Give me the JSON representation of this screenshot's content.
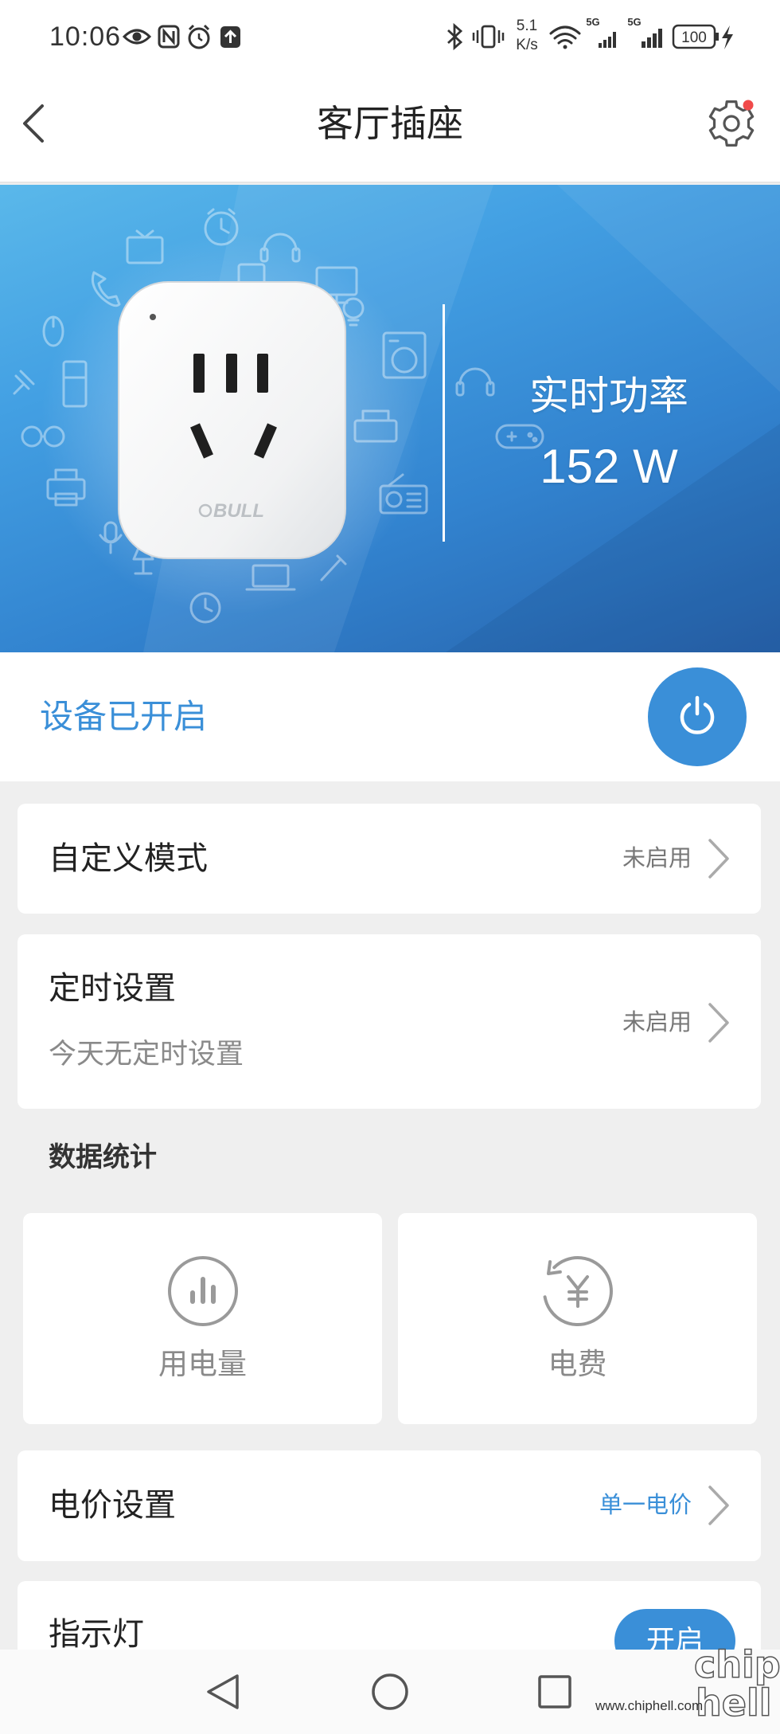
{
  "status_bar": {
    "time": "10:06",
    "net_speed": "5.1",
    "net_speed_unit": "K/s",
    "signal_1_label": "5G",
    "signal_2_label": "5G",
    "battery_level": "100",
    "left_icons": [
      "eye-icon",
      "nfc-icon",
      "alarm-icon",
      "upload-icon"
    ],
    "right_icons": [
      "bluetooth-icon",
      "vibrate-icon",
      "wifi-icon",
      "signal-icon",
      "signal-icon",
      "battery-icon",
      "charging-icon"
    ]
  },
  "header": {
    "title": "客厅插座",
    "back_icon": "chevron-left-icon",
    "settings_icon": "gear-icon",
    "settings_has_badge": true
  },
  "hero": {
    "power_label": "实时功率",
    "power_value": "152",
    "power_unit": "W",
    "device_brand": "BULL",
    "device_image": "smart-plug-image"
  },
  "device_status": {
    "text": "设备已开启",
    "power_icon": "power-icon"
  },
  "custom_mode": {
    "label": "自定义模式",
    "status": "未启用",
    "icon": "chevron-right-icon"
  },
  "timer": {
    "label": "定时设置",
    "subtitle": "今天无定时设置",
    "status": "未启用",
    "icon": "chevron-right-icon"
  },
  "statistics": {
    "title": "数据统计",
    "items": [
      {
        "label": "用电量",
        "icon": "bar-chart-icon"
      },
      {
        "label": "电费",
        "icon": "yen-refresh-icon"
      }
    ]
  },
  "price_setting": {
    "label": "电价设置",
    "value": "单一电价",
    "icon": "chevron-right-icon"
  },
  "indicator_light": {
    "label": "指示灯",
    "button_label": "开启"
  },
  "nav_bar": {
    "icons": [
      "back-triangle-icon",
      "home-circle-icon",
      "recents-square-icon"
    ]
  },
  "watermark": {
    "logo_top": "chip",
    "logo_bottom": "hell",
    "url": "www.chiphell.com"
  },
  "colors": {
    "accent": "#3a8fd8",
    "page_bg": "#efefef",
    "card_bg": "#ffffff",
    "badge": "#f04a4a",
    "hero_top": "#5ab8ea",
    "hero_bottom": "#2762ab"
  }
}
